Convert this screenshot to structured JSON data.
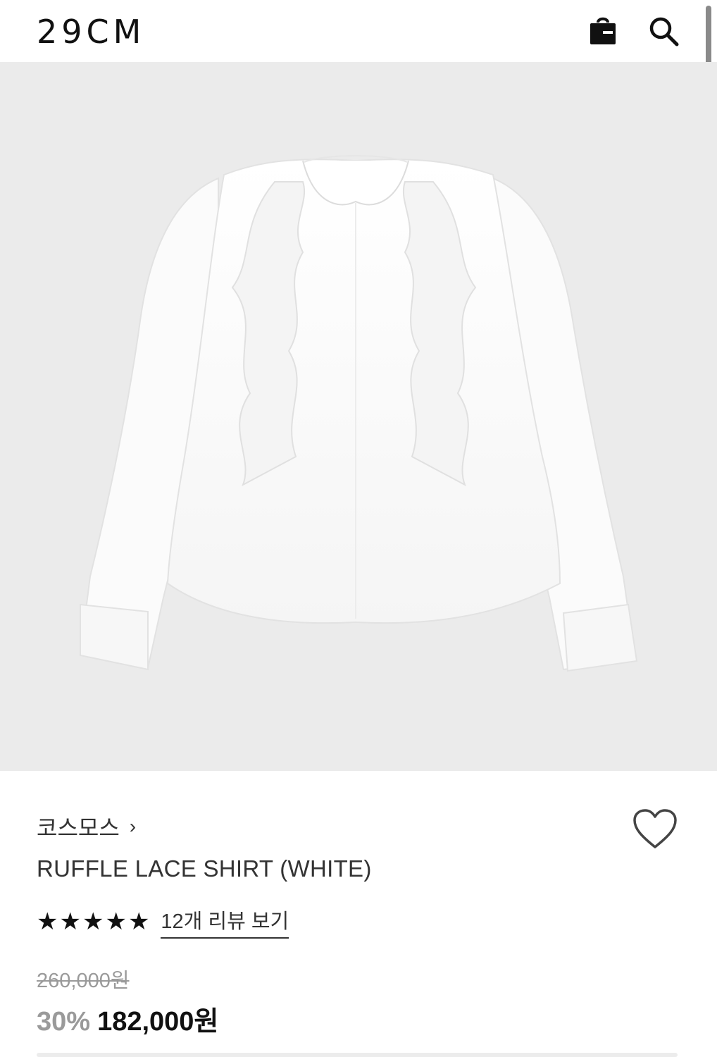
{
  "header": {
    "logo": "29CM",
    "bag_icon": "shopping-bag-icon",
    "search_icon": "search-icon"
  },
  "product": {
    "image_subject": "white ruffle lace long-sleeve shirt",
    "brand": "코스모스",
    "brand_chevron": "›",
    "name": "RUFFLE LACE SHIRT (WHITE)",
    "rating_stars": 5,
    "review_link": "12개 리뷰 보기",
    "original_price": "260,000원",
    "discount": "30%",
    "sale_price": "182,000원",
    "wishlist_icon": "heart-icon"
  },
  "colors": {
    "hero_background": "#ebebeb",
    "text": "#1a1a1a",
    "muted": "#9a9a9a"
  }
}
